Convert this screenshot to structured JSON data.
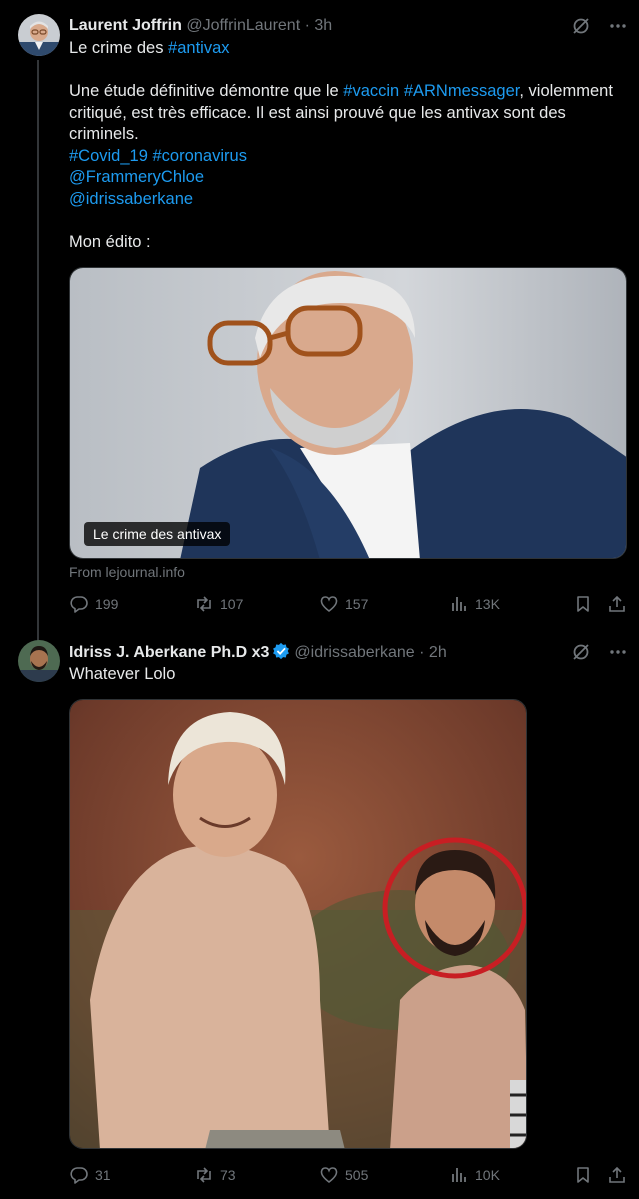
{
  "colors": {
    "link": "#1d9bf0",
    "muted": "#71767b",
    "text": "#e7e9ea",
    "background": "#000000",
    "verified": "#1d9bf0",
    "circle": "#c81e23"
  },
  "tweets": [
    {
      "author": {
        "name": "Laurent Joffrin",
        "handle": "@JoffrinLaurent",
        "dot": "·",
        "time": "3h"
      },
      "lines": [
        [
          {
            "t": "Le crime des "
          },
          {
            "t": "#antivax",
            "link": true
          }
        ],
        [],
        [
          {
            "t": "Une étude définitive démontre que le "
          },
          {
            "t": "#vaccin",
            "link": true
          },
          {
            "t": " "
          },
          {
            "t": "#ARNmessager",
            "link": true
          },
          {
            "t": ", violemment"
          }
        ],
        [
          {
            "t": "critiqué, est très efficace. Il est ainsi prouvé que les antivax sont des"
          }
        ],
        [
          {
            "t": "criminels."
          }
        ],
        [
          {
            "t": "#Covid_19",
            "link": true
          },
          {
            "t": " "
          },
          {
            "t": "#coronavirus",
            "link": true
          }
        ],
        [
          {
            "t": "@FrammeryChloe",
            "link": true
          }
        ],
        [
          {
            "t": "@idrissaberkane",
            "link": true
          }
        ],
        [],
        [
          {
            "t": "Mon édito :"
          }
        ]
      ],
      "card_caption": "Le crime des antivax",
      "source": "From lejournal.info",
      "stats": {
        "replies": "199",
        "reposts": "107",
        "likes": "157",
        "views": "13K"
      }
    },
    {
      "author": {
        "name": "Idriss J. Aberkane Ph.D x3",
        "handle": "@idrissaberkane",
        "dot": "·",
        "time": "2h"
      },
      "lines": [
        [
          {
            "t": "Whatever Lolo"
          }
        ]
      ],
      "stats": {
        "replies": "31",
        "reposts": "73",
        "likes": "505",
        "views": "10K"
      }
    }
  ],
  "icons": [
    "grok-icon",
    "more-icon",
    "reply-icon",
    "repost-icon",
    "like-icon",
    "views-icon",
    "bookmark-icon",
    "share-icon",
    "verified-icon"
  ]
}
